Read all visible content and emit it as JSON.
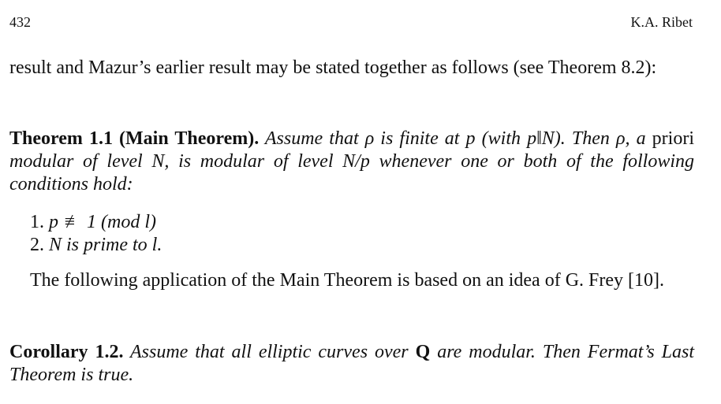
{
  "header": {
    "page_number": "432",
    "running_head": "K.A. Ribet"
  },
  "intro": {
    "text": "result and Mazur’s earlier result may be stated together as follows (see Theorem 8.2):"
  },
  "theorem": {
    "label": "Theorem 1.1 (Main Theorem).",
    "s1": " Assume that ρ is finite at p (with p‖N). Then ρ, a ",
    "priori": "priori",
    "s2": " modular of level N, is modular of level N/p whenever one or both of the following conditions hold:"
  },
  "conditions": [
    {
      "num": "1.",
      "text": "p ≢ 1 (mod l)"
    },
    {
      "num": "2.",
      "text": "N is prime to l."
    }
  ],
  "application": {
    "text": "The following application of the Main Theorem is based on an idea of G. Frey [10]."
  },
  "corollary": {
    "label": "Corollary 1.2.",
    "s1": " Assume that all elliptic curves over ",
    "field": "Q",
    "s2": " are modular. Then Fermat’s Last Theorem is true."
  }
}
